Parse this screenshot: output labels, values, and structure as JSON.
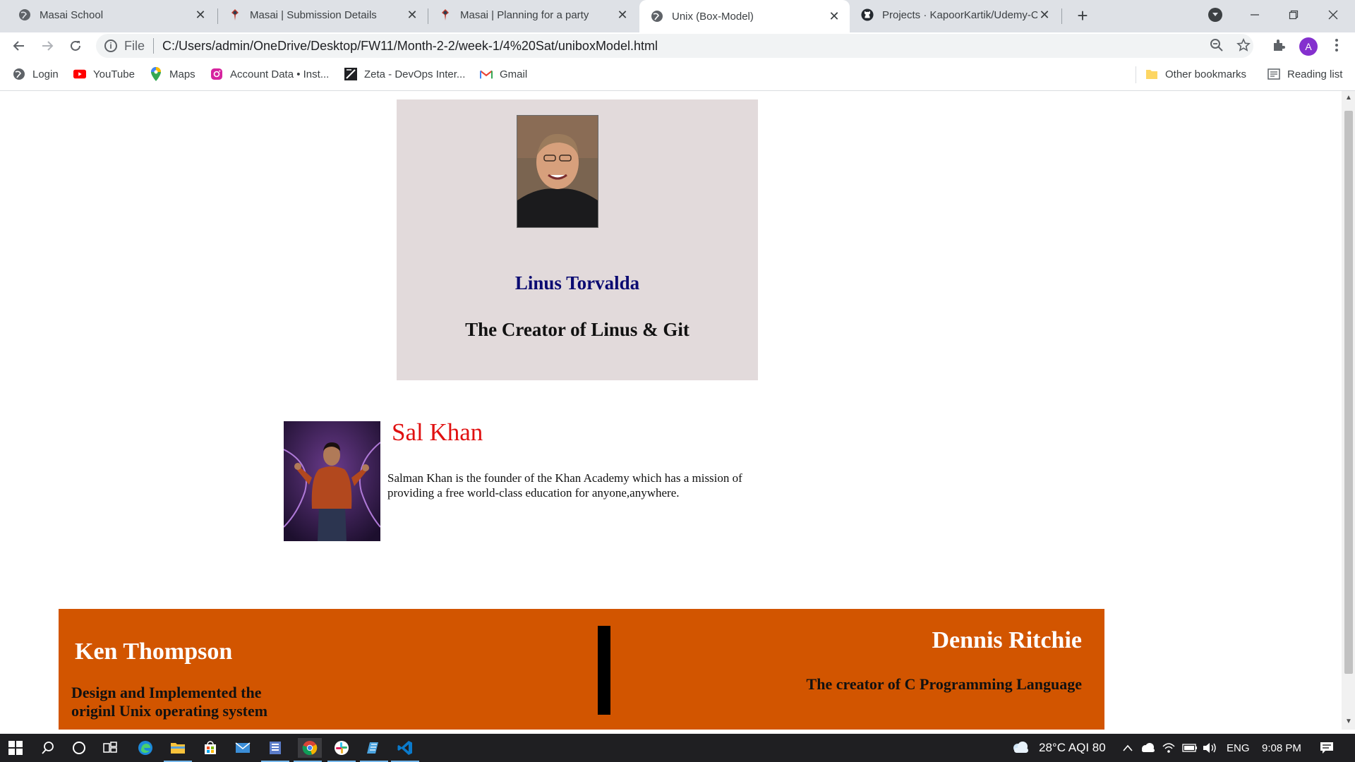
{
  "tabs": [
    {
      "title": "Masai School",
      "icon": "globe-icon"
    },
    {
      "title": "Masai | Submission Details",
      "icon": "masai-icon"
    },
    {
      "title": "Masai | Planning for a party",
      "icon": "masai-icon"
    },
    {
      "title": "Unix (Box-Model)",
      "icon": "globe-icon",
      "active": true
    },
    {
      "title": "Projects · KapoorKartik/Udemy-C",
      "icon": "github-icon"
    }
  ],
  "toolbar": {
    "scheme_label": "File",
    "url": "C:/Users/admin/OneDrive/Desktop/FW11/Month-2-2/week-1/4%20Sat/uniboxModel.html",
    "profile_initial": "A"
  },
  "bookmarks": {
    "items": [
      {
        "label": "Login",
        "icon": "globe-icon"
      },
      {
        "label": "YouTube",
        "icon": "youtube-icon"
      },
      {
        "label": "Maps",
        "icon": "maps-icon"
      },
      {
        "label": "Account Data • Inst...",
        "icon": "instagram-icon"
      },
      {
        "label": "Zeta - DevOps Inter...",
        "icon": "zeta-icon"
      },
      {
        "label": "Gmail",
        "icon": "gmail-icon"
      }
    ],
    "other": "Other bookmarks",
    "reading": "Reading list"
  },
  "page": {
    "linus": {
      "name": "Linus Torvalda",
      "subtitle": "The Creator of Linus & Git"
    },
    "sal": {
      "name": "Sal Khan",
      "description": "Salman Khan is the founder of the Khan Academy which has a mission of providing a free world-class education for anyone,anywhere."
    },
    "ken": {
      "name": "Ken Thompson",
      "description": "Design and Implemented the originl Unix operating system"
    },
    "dennis": {
      "name": "Dennis Ritchie",
      "description": "The creator of C Programming Language"
    },
    "colors": {
      "linus_bg": "#e2dadb",
      "linus_name": "#0b0b72",
      "sal_name": "#e01010",
      "footer_bg": "#d25500"
    }
  },
  "taskbar": {
    "weather": "28°C  AQI 80",
    "language": "ENG",
    "time": "9:08 PM"
  }
}
